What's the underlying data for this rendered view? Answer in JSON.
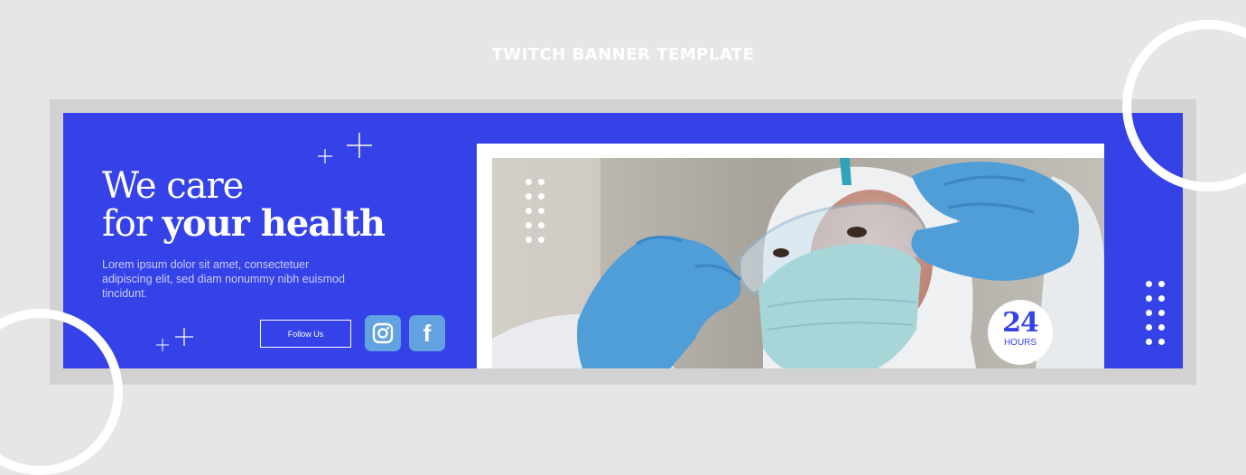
{
  "page_title": "TWITCH BANNER TEMPLATE",
  "headline": {
    "line1": "We care",
    "line2_prefix": "for ",
    "line2_bold": "your health"
  },
  "body_text": "Lorem ipsum dolor sit amet, consectetuer adipiscing elit, sed diam nonummy nibh euismod tincidunt.",
  "follow_button": "Follow Us",
  "social": {
    "instagram_icon": "instagram-icon",
    "facebook_icon": "facebook-icon",
    "facebook_glyph": "f"
  },
  "badge": {
    "number": "24",
    "label": "HOURS"
  },
  "colors": {
    "background": "#e6e6e6",
    "brand_blue": "#3542e8",
    "social_icon_bg": "#62a2e0",
    "white": "#ffffff"
  }
}
